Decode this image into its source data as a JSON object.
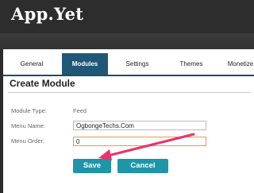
{
  "header": {
    "app_title": "App.Yet"
  },
  "tabs": [
    {
      "label": "General"
    },
    {
      "label": "Modules",
      "active": true
    },
    {
      "label": "Settings"
    },
    {
      "label": "Themes"
    },
    {
      "label": "Monetize"
    }
  ],
  "form": {
    "title": "Create Module",
    "module_type_label": "Module Type:",
    "module_type_value": "Feed",
    "menu_name_label": "Menu Name:",
    "menu_name_value": "OgbongeTechs.Com",
    "menu_order_label": "Menu Order:",
    "menu_order_value": "0"
  },
  "buttons": {
    "save": "Save",
    "cancel": "Cancel"
  },
  "colors": {
    "accent_tab": "#1f5877",
    "button": "#1f95a8",
    "annotation_arrow": "#e8336b"
  }
}
